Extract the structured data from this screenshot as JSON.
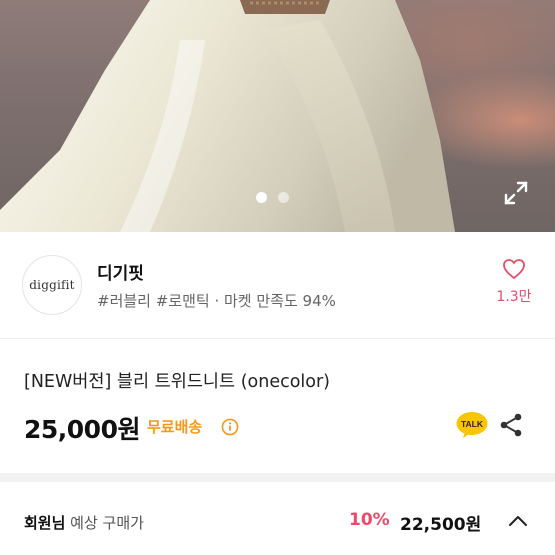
{
  "shop": {
    "logo_text": "diggifit",
    "name": "디기핏",
    "tags": "#러블리 #로맨틱 · 마켓 만족도 94%",
    "likes": "1.3만"
  },
  "carousel": {
    "total_slides": 2,
    "active_slide": 1
  },
  "product": {
    "title": "[NEW버전] 블리 트위드니트 (onecolor)",
    "price": "25,000원",
    "shipping": "무료배송"
  },
  "member": {
    "label_bold": "회원님",
    "label_rest": " 예상 구매가",
    "discount": "10%",
    "price": "22,500원"
  },
  "colors": {
    "accent_pink": "#e0506a",
    "discount_pink": "#f0486b",
    "shipping_orange": "#f39a1c",
    "talk_yellow": "#f7c600"
  },
  "icons": [
    "expand-icon",
    "heart-icon",
    "info-icon",
    "kakao-talk-icon",
    "share-icon",
    "chevron-up-icon"
  ]
}
